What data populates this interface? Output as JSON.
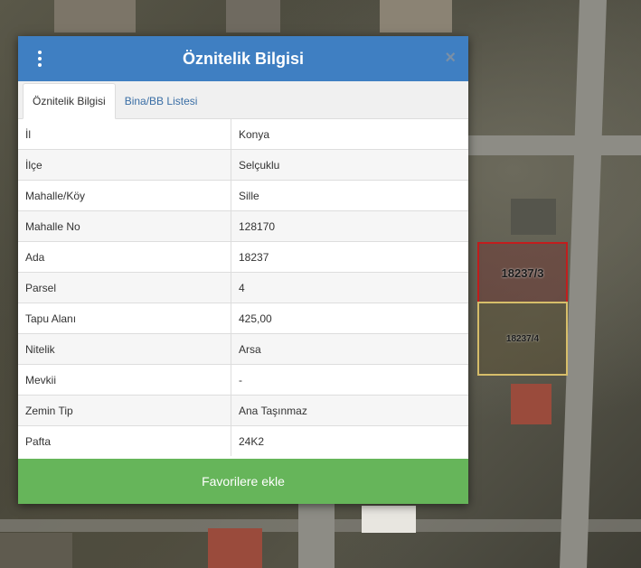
{
  "map": {
    "parcel_3_label": "18237/3",
    "parcel_4_label": "18237/4"
  },
  "modal": {
    "title": "Öznitelik Bilgisi",
    "close_symbol": "×",
    "tabs": [
      {
        "label": "Öznitelik Bilgisi",
        "active": true
      },
      {
        "label": "Bina/BB Listesi",
        "active": false
      }
    ],
    "rows": [
      {
        "key": "İl",
        "value": "Konya"
      },
      {
        "key": "İlçe",
        "value": "Selçuklu"
      },
      {
        "key": "Mahalle/Köy",
        "value": "Sille"
      },
      {
        "key": "Mahalle No",
        "value": "128170"
      },
      {
        "key": "Ada",
        "value": "18237"
      },
      {
        "key": "Parsel",
        "value": "4"
      },
      {
        "key": "Tapu Alanı",
        "value": "425,00"
      },
      {
        "key": "Nitelik",
        "value": "Arsa"
      },
      {
        "key": "Mevkii",
        "value": "-"
      },
      {
        "key": "Zemin Tip",
        "value": "Ana Taşınmaz"
      },
      {
        "key": "Pafta",
        "value": "24K2"
      }
    ],
    "favorite_button": "Favorilere ekle"
  },
  "colors": {
    "header": "#3f7fc2",
    "favorite_button": "#66b55a",
    "parcel_selected_border": "#d7be6a",
    "parcel_other_border": "#c21d1d"
  },
  "icons": {
    "menu": "vertical-dots-icon",
    "close": "close-icon"
  }
}
